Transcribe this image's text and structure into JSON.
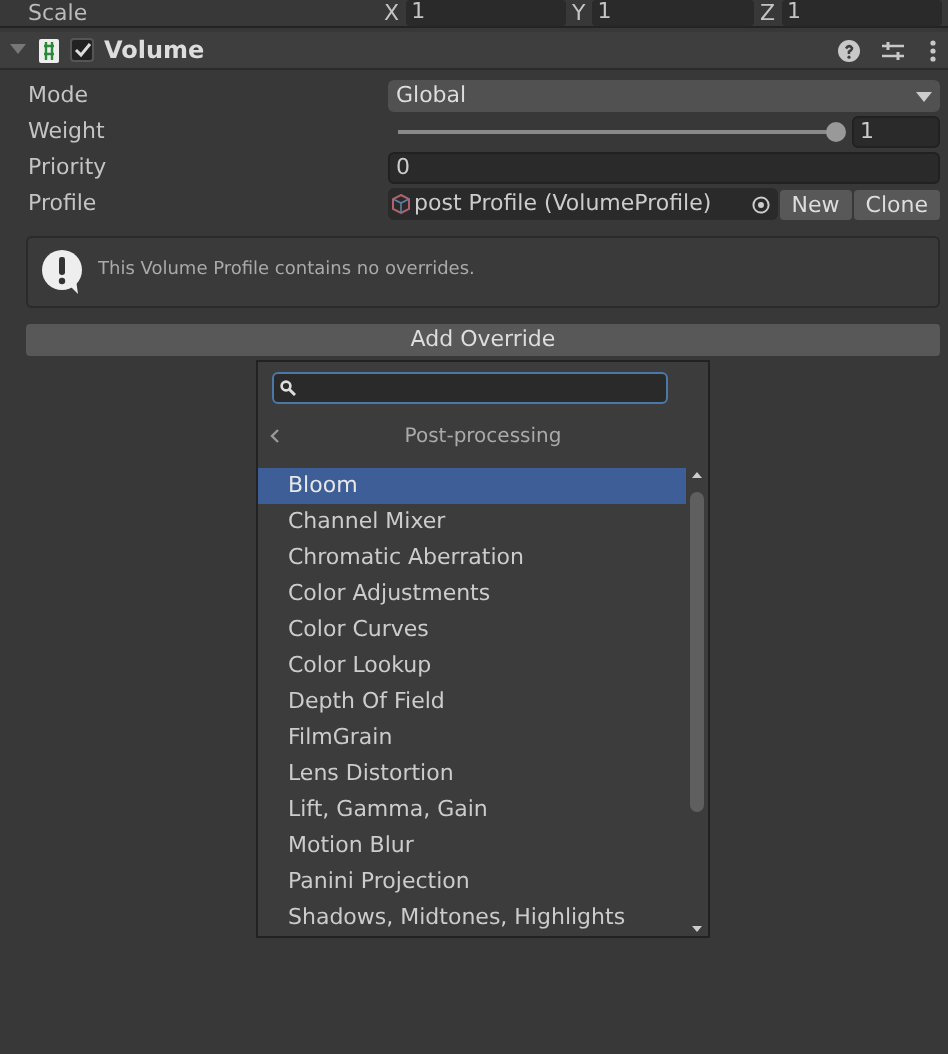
{
  "transform_row": {
    "label": "Scale",
    "fields": [
      {
        "axis": "X",
        "value": "1"
      },
      {
        "axis": "Y",
        "value": "1"
      },
      {
        "axis": "Z",
        "value": "1"
      }
    ]
  },
  "component": {
    "title": "Volume",
    "enabled": true,
    "expanded": true
  },
  "properties": [
    {
      "kind": "dropdown",
      "label": "Mode",
      "value": "Global"
    },
    {
      "kind": "slider",
      "label": "Weight",
      "level": 1,
      "value": "1"
    },
    {
      "kind": "number",
      "label": "Priority",
      "value": "0"
    },
    {
      "kind": "object",
      "label": "Profile",
      "value": "post Profile (VolumeProfile)",
      "buttons": [
        "New",
        "Clone"
      ]
    }
  ],
  "help_box": {
    "text": "This Volume Profile contains no overrides."
  },
  "add_override_button": "Add Override",
  "popup": {
    "header": "Post-processing",
    "items": [
      {
        "label": "Bloom",
        "selected": true
      },
      {
        "label": "Channel Mixer",
        "selected": false
      },
      {
        "label": "Chromatic Aberration",
        "selected": false
      },
      {
        "label": "Color Adjustments",
        "selected": false
      },
      {
        "label": "Color Curves",
        "selected": false
      },
      {
        "label": "Color Lookup",
        "selected": false
      },
      {
        "label": "Depth Of Field",
        "selected": false
      },
      {
        "label": "FilmGrain",
        "selected": false
      },
      {
        "label": "Lens Distortion",
        "selected": false
      },
      {
        "label": "Lift, Gamma, Gain",
        "selected": false
      },
      {
        "label": "Motion Blur",
        "selected": false
      },
      {
        "label": "Panini Projection",
        "selected": false
      },
      {
        "label": "Shadows, Midtones, Highlights",
        "selected": false
      }
    ]
  }
}
